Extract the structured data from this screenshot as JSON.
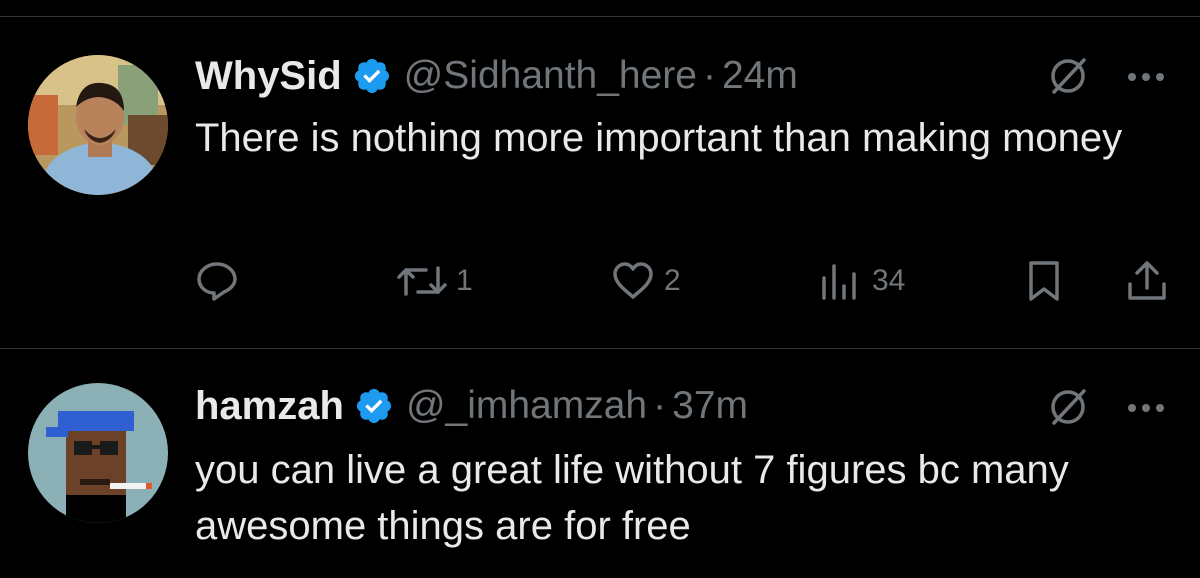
{
  "tweets": [
    {
      "display_name": "WhySid",
      "handle": "@Sidhanth_here",
      "separator": "·",
      "time": "24m",
      "text": "There is nothing more important than making money",
      "verified": true,
      "actions": {
        "reply_count": "",
        "retweet_count": "1",
        "like_count": "2",
        "view_count": "34"
      }
    },
    {
      "display_name": "hamzah",
      "handle": "@_imhamzah",
      "separator": "·",
      "time": "37m",
      "text": "you can live a great life without 7 figures bc many awesome things are for free",
      "verified": true
    }
  ],
  "icons": {
    "verified": "verified-badge-icon",
    "grok": "grok-icon",
    "more": "more-icon",
    "reply": "reply-icon",
    "retweet": "retweet-icon",
    "like": "heart-icon",
    "views": "views-icon",
    "bookmark": "bookmark-icon",
    "share": "share-icon"
  },
  "colors": {
    "background": "#000000",
    "text_primary": "#e7e9ea",
    "text_secondary": "#71767b",
    "verified_blue": "#1d9bf0",
    "divider": "#2f3336"
  }
}
